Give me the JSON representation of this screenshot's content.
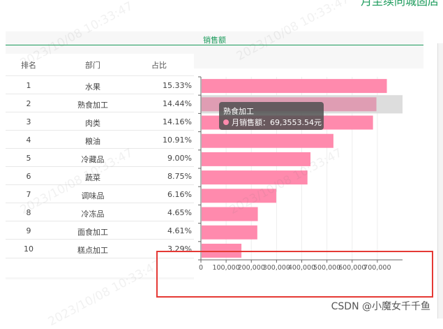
{
  "page_title": "月至续同城固店",
  "section_title": "销售额",
  "table": {
    "headers": {
      "rank": "排名",
      "dept": "部门",
      "pct": "占比"
    },
    "rows": [
      {
        "rank": "1",
        "dept": "水果",
        "pct": "15.33%"
      },
      {
        "rank": "2",
        "dept": "熟食加工",
        "pct": "14.44%"
      },
      {
        "rank": "3",
        "dept": "肉类",
        "pct": "14.16%"
      },
      {
        "rank": "4",
        "dept": "粮油",
        "pct": "10.91%"
      },
      {
        "rank": "5",
        "dept": "冷藏品",
        "pct": "9.00%"
      },
      {
        "rank": "6",
        "dept": "蔬菜",
        "pct": "8.75%"
      },
      {
        "rank": "7",
        "dept": "调味品",
        "pct": "6.16%"
      },
      {
        "rank": "8",
        "dept": "冷冻品",
        "pct": "4.65%"
      },
      {
        "rank": "9",
        "dept": "面食加工",
        "pct": "4.61%"
      },
      {
        "rank": "10",
        "dept": "糕点加工",
        "pct": "3.29%"
      }
    ]
  },
  "tooltip": {
    "title": "熟食加工",
    "label": "月销售额：69,3553.54元"
  },
  "chart_data": {
    "type": "bar",
    "orientation": "horizontal",
    "categories": [
      "水果",
      "熟食加工",
      "肉类",
      "粮油",
      "冷藏品",
      "蔬菜",
      "调味品",
      "冷冻品",
      "面食加工",
      "糕点加工"
    ],
    "values": [
      735000,
      693553.54,
      680000,
      523000,
      432000,
      420000,
      296000,
      223000,
      221000,
      158000
    ],
    "highlighted_index": 1,
    "bar_color": "#ff8aad",
    "highlight_color": "#df9db3",
    "xlim": [
      0,
      800000
    ],
    "xticks": [
      "0",
      "100,000",
      "200,000",
      "300,000",
      "400,000",
      "500,000",
      "600,000",
      "700,000"
    ]
  },
  "watermark_text": "2023/10/08 10:33:47",
  "footer_credit": "CSDN @小魔女千千鱼"
}
